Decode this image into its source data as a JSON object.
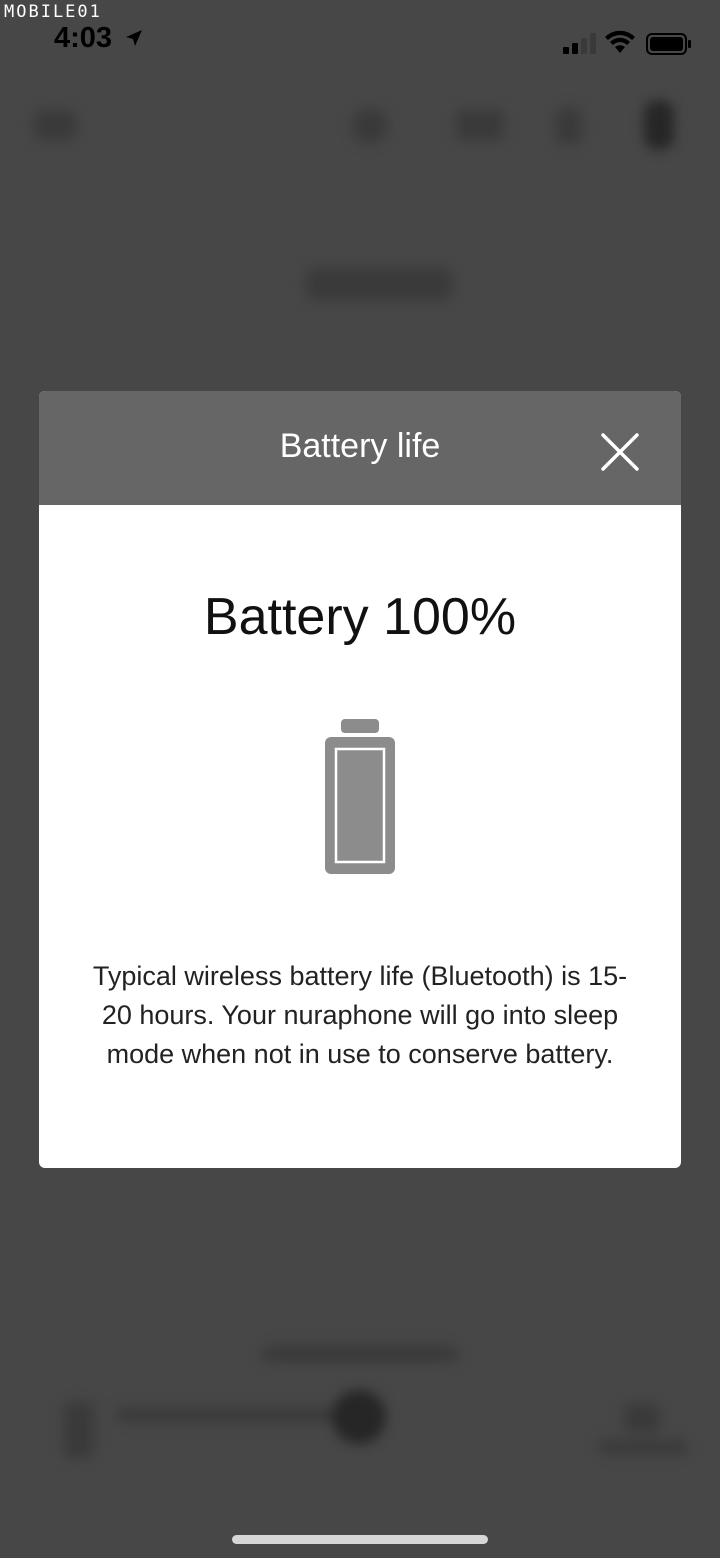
{
  "status_bar": {
    "watermark": "MOBILE01",
    "time": "4:03",
    "icons": [
      "location-arrow-icon",
      "cellular-signal-icon",
      "wifi-icon",
      "battery-icon"
    ]
  },
  "modal": {
    "title": "Battery life",
    "close_icon": "close-icon",
    "heading": "Battery 100%",
    "battery_level": 1.0,
    "battery_graphic_icon": "battery-full-icon",
    "description": "Typical wireless battery life (Bluetooth) is 15-20 hours. Your nuraphone will go into sleep mode when not in use to conserve battery."
  },
  "colors": {
    "overlay_bg": "#474747",
    "header_bg": "#666666",
    "modal_bg": "#ffffff",
    "battery_gray": "#8c8c8c"
  }
}
